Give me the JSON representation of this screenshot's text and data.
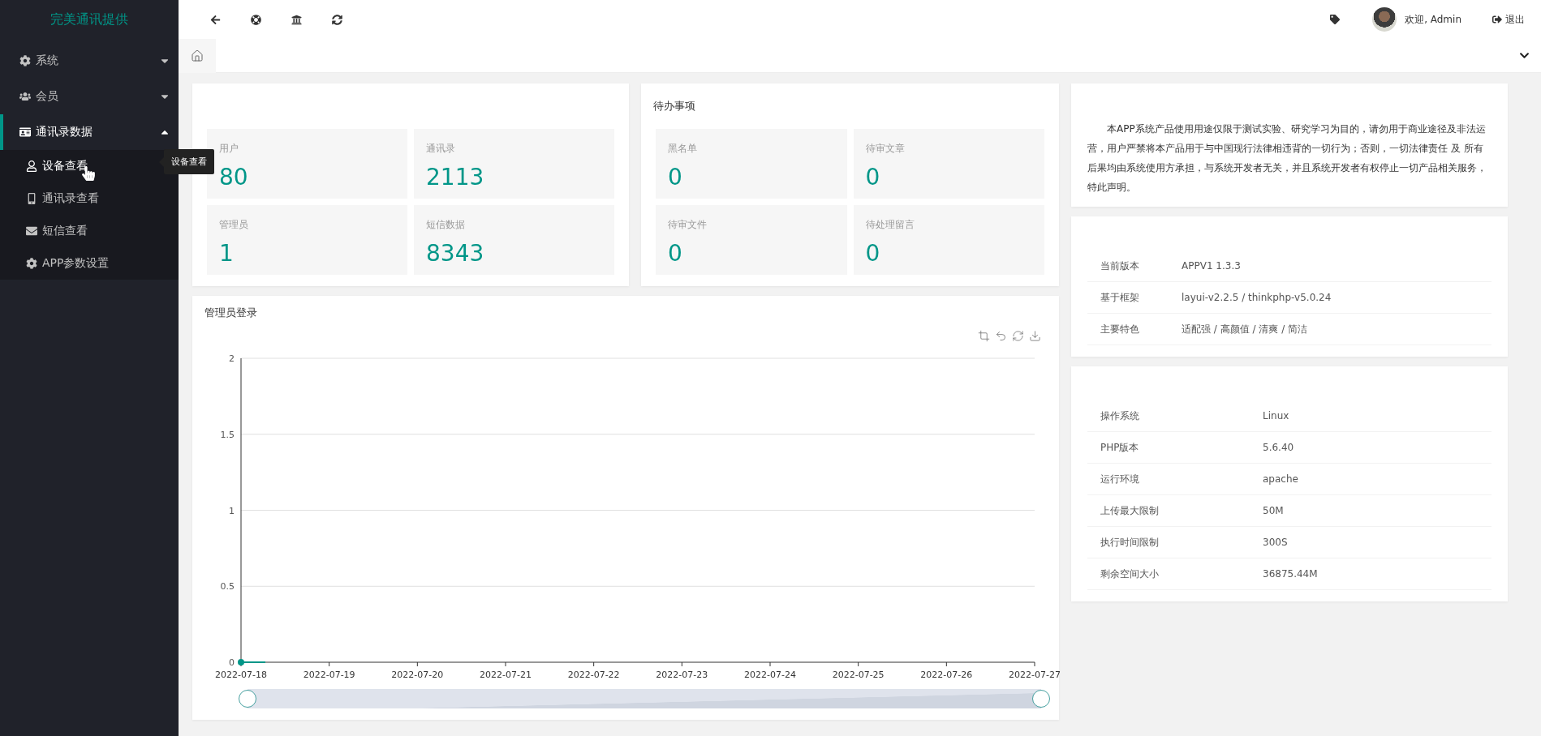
{
  "sidebar": {
    "logo": "完美通讯提供",
    "groups": [
      {
        "label": "系统",
        "expanded": false,
        "selected": false
      },
      {
        "label": "会员",
        "expanded": false,
        "selected": false
      },
      {
        "label": "通讯录数据",
        "expanded": true,
        "selected": true,
        "children": [
          {
            "label": "设备查看",
            "selected": true
          },
          {
            "label": "通讯录查看",
            "selected": false
          },
          {
            "label": "短信查看",
            "selected": false
          },
          {
            "label": "APP参数设置",
            "selected": false
          }
        ]
      }
    ],
    "tooltip": "设备查看"
  },
  "header": {
    "welcome": "欢迎, Admin",
    "logout": "退出"
  },
  "stats": {
    "tiles": [
      {
        "label": "用户",
        "value": "80"
      },
      {
        "label": "通讯录",
        "value": "2113"
      },
      {
        "label": "管理员",
        "value": "1"
      },
      {
        "label": "短信数据",
        "value": "8343"
      }
    ]
  },
  "todo": {
    "title": "待办事项",
    "tiles": [
      {
        "label": "黑名单",
        "value": "0"
      },
      {
        "label": "待审文章",
        "value": "0"
      },
      {
        "label": "待审文件",
        "value": "0"
      },
      {
        "label": "待处理留言",
        "value": "0"
      }
    ]
  },
  "chart": {
    "title": "管理员登录",
    "zoom": {
      "level": 1
    },
    "chart_data": {
      "type": "line",
      "grid": true,
      "categories": [
        "2022-07-18",
        "2022-07-19",
        "2022-07-20",
        "2022-07-21",
        "2022-07-22",
        "2022-07-23",
        "2022-07-24",
        "2022-07-25",
        "2022-07-26",
        "2022-07-27"
      ],
      "series": [
        {
          "color": "#009688",
          "marker": true,
          "values": [
            0,
            null,
            null,
            null,
            null,
            null,
            null,
            null,
            null,
            null
          ]
        }
      ],
      "ylim": [
        0,
        2
      ],
      "yticks": [
        0,
        {
          "value": 0.5,
          "label": "0.5"
        },
        1,
        {
          "value": 1.5,
          "label": "1.5"
        },
        2
      ]
    }
  },
  "notice": "本APP系统产品使用用途仅限于测试实验、研究学习为目的，请勿用于商业途径及非法运营，用户严禁将本产品用于与中国现行法律相违背的一切行为；否则，一切法律责任 及 所有后果均由系统使用方承担，与系统开发者无关，并且系统开发者有权停止一切产品相关服务，特此声明。",
  "version_table": [
    {
      "label": "当前版本",
      "value": "APPV1 1.3.3"
    },
    {
      "label": "基于框架",
      "value": "layui-v2.2.5 / thinkphp-v5.0.24"
    },
    {
      "label": "主要特色",
      "value": "适配强 / 高颜值 / 清爽 / 简洁"
    }
  ],
  "system_table": [
    {
      "label": "操作系统",
      "value": "Linux"
    },
    {
      "label": "PHP版本",
      "value": "5.6.40"
    },
    {
      "label": "运行环境",
      "value": "apache"
    },
    {
      "label": "上传最大限制",
      "value": "50M"
    },
    {
      "label": "执行时间限制",
      "value": "300S"
    },
    {
      "label": "剩余空间大小",
      "value": "36875.44M"
    }
  ]
}
